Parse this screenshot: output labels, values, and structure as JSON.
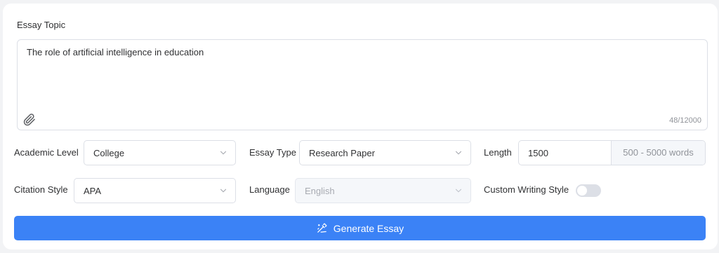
{
  "topic": {
    "label": "Essay Topic",
    "value": "The role of artificial intelligence in education",
    "counter": "48/12000",
    "attach_icon": "paperclip-icon"
  },
  "academic_level": {
    "label": "Academic Level",
    "value": "College"
  },
  "essay_type": {
    "label": "Essay Type",
    "value": "Research Paper"
  },
  "length": {
    "label": "Length",
    "value": "1500",
    "range_hint": "500 - 5000 words"
  },
  "citation_style": {
    "label": "Citation Style",
    "value": "APA"
  },
  "language": {
    "label": "Language",
    "value": "English",
    "disabled": true
  },
  "custom_style": {
    "label": "Custom Writing Style",
    "enabled": false
  },
  "generate_button": {
    "label": "Generate Essay",
    "icon": "magic-pen-icon"
  },
  "colors": {
    "accent": "#3b82f6",
    "border": "#dcdfe6",
    "toggle_off": "#dcdfe6",
    "muted_text": "#909399"
  }
}
